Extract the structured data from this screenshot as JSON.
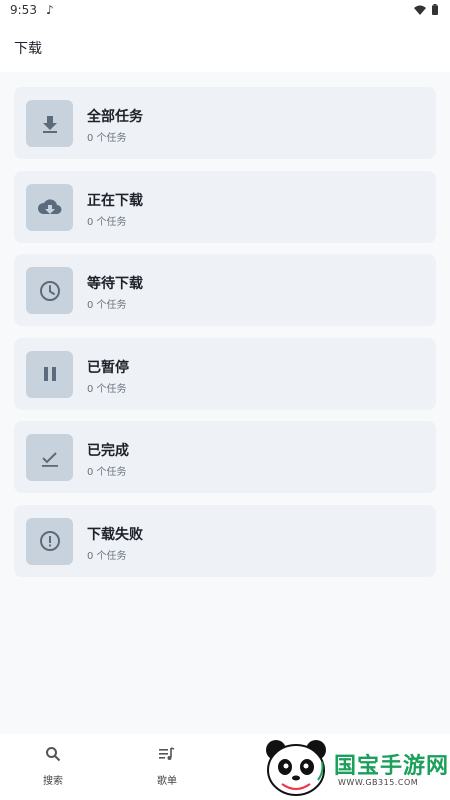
{
  "status_bar": {
    "time": "9:53",
    "note_icon": "music-note-icon",
    "wifi_icon": "wifi-icon",
    "battery_icon": "battery-icon"
  },
  "app_bar": {
    "title": "下载"
  },
  "download_categories": [
    {
      "title": "全部任务",
      "subtitle": "0 个任务",
      "icon": "download-icon"
    },
    {
      "title": "正在下载",
      "subtitle": "0 个任务",
      "icon": "cloud-download-icon"
    },
    {
      "title": "等待下载",
      "subtitle": "0 个任务",
      "icon": "clock-icon"
    },
    {
      "title": "已暂停",
      "subtitle": "0 个任务",
      "icon": "pause-icon"
    },
    {
      "title": "已完成",
      "subtitle": "0 个任务",
      "icon": "check-icon"
    },
    {
      "title": "下载失败",
      "subtitle": "0 个任务",
      "icon": "error-icon"
    }
  ],
  "bottom_nav": {
    "search_label": "搜索",
    "playlist_label": "歌单"
  },
  "watermark": {
    "text": "国宝手游网",
    "url": "WWW.GB315.COM"
  },
  "colors": {
    "card_bg": "#eef2f6",
    "icon_tile": "#c8d2dd",
    "icon_fg": "#5b6b7c",
    "watermark_green": "#1aa05a"
  }
}
